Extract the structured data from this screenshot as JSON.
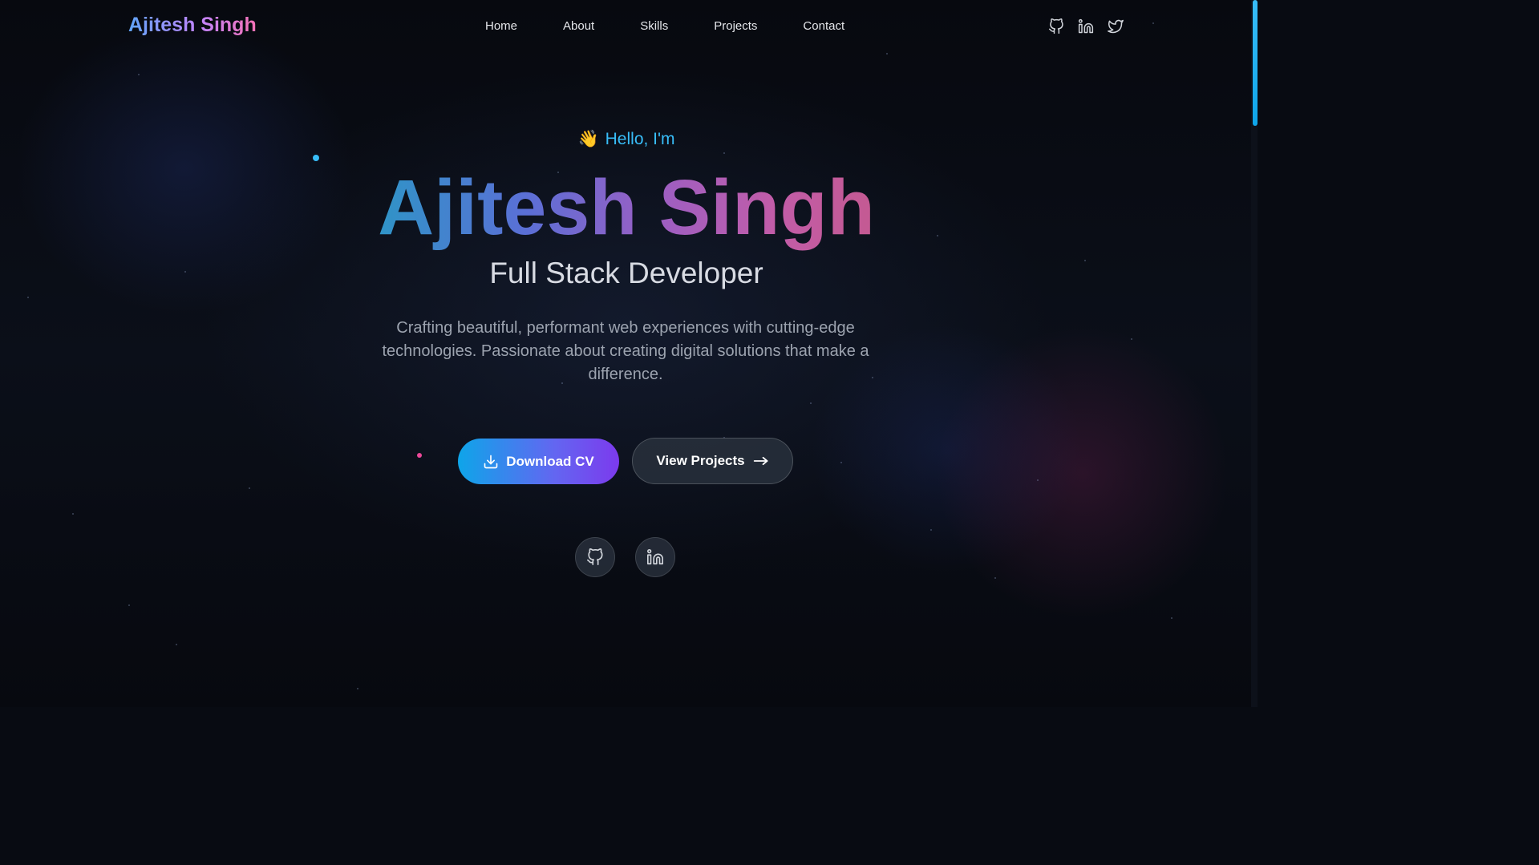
{
  "header": {
    "logo": "Ajitesh Singh",
    "nav": [
      "Home",
      "About",
      "Skills",
      "Projects",
      "Contact"
    ],
    "social_icons": [
      "github-icon",
      "linkedin-icon",
      "twitter-icon"
    ]
  },
  "hero": {
    "wave_emoji": "👋",
    "greeting": "Hello, I'm",
    "name": "Ajitesh Singh",
    "role": "Full Stack Developer",
    "description": "Crafting beautiful, performant web experiences with cutting-edge technologies. Passionate about creating digital solutions that make a difference.",
    "download_cv_label": "Download CV",
    "view_projects_label": "View Projects",
    "social_icons": [
      "github-icon",
      "linkedin-icon"
    ]
  },
  "colors": {
    "background": "#080b12",
    "accent_blue": "#38bdf8",
    "accent_purple": "#7c3aed",
    "accent_pink": "#f472b6",
    "text_primary": "#e5e7eb",
    "text_muted": "#9ca3af"
  }
}
